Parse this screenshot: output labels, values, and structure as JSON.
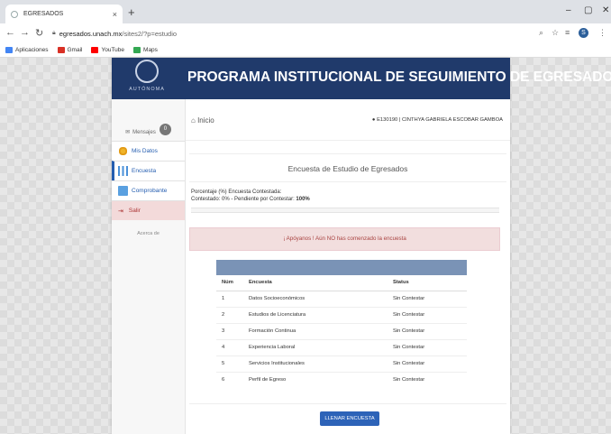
{
  "browser": {
    "tab_title": "EGRESADOS",
    "tab_close": "×",
    "new_tab": "+",
    "url_host": "egresados.unach.mx",
    "url_path": "/sites2/?p=estudio",
    "bookmarks": [
      {
        "label": "Aplicaciones",
        "color": "#4285f4"
      },
      {
        "label": "Gmail",
        "color": "#d93025"
      },
      {
        "label": "YouTube",
        "color": "#ff0000"
      },
      {
        "label": "Maps",
        "color": "#34a853"
      }
    ],
    "profile_initial": "S"
  },
  "header": {
    "logo_text": "AUTÓNOMA",
    "title": "PROGRAMA INSTITUCIONAL DE SEGUIMIENTO DE EGRESADOS"
  },
  "sidebar": {
    "messages_label": "Mensajes",
    "messages_count": "0",
    "items": [
      {
        "label": "Mis Datos",
        "icon": "gears-icon"
      },
      {
        "label": "Encuesta",
        "icon": "chart-icon"
      },
      {
        "label": "Comprobante",
        "icon": "document-icon"
      },
      {
        "label": "Salir",
        "icon": "logout-icon"
      }
    ],
    "about": "Acerca de"
  },
  "topbar": {
    "home_label": "Inicio",
    "user": "E130190 | CINTHYA GABRIELA ESCOBAR GAMBOA"
  },
  "survey": {
    "title": "Encuesta de Estudio de Egresados",
    "percent_label": "Porcentaje (%) Encuesta Contestada:",
    "status_line": "Contestado: 0% - Pendiente por Contestar:",
    "pending_value": "100%",
    "answered_fraction": 0,
    "alert": "¡ Apóyanos ! Aún NO has comenzado la encuesta",
    "table": {
      "headers": [
        "Núm",
        "Encuesta",
        "Status"
      ],
      "rows": [
        [
          "1",
          "Datos Socioeconómicos",
          "Sin Contestar"
        ],
        [
          "2",
          "Estudios de Licenciatura",
          "Sin Contestar"
        ],
        [
          "3",
          "Formación Continua",
          "Sin Contestar"
        ],
        [
          "4",
          "Experiencia Laboral",
          "Sin Contestar"
        ],
        [
          "5",
          "Servicios Institucionales",
          "Sin Contestar"
        ],
        [
          "6",
          "Perfil de Egreso",
          "Sin Contestar"
        ]
      ]
    },
    "button": "LLENAR ENCUESTA"
  },
  "colors": {
    "header_bg": "#203a6b",
    "link_blue": "#245db0",
    "alert_bg": "#f2dede",
    "button_bg": "#2d63b8"
  }
}
